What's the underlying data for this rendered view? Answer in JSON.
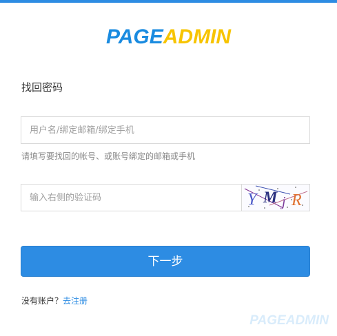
{
  "logo": {
    "part1": "PAGE",
    "part2": "ADMIN"
  },
  "page_title": "找回密码",
  "user_field": {
    "placeholder": "用户名/绑定邮箱/绑定手机",
    "value": ""
  },
  "user_hint": "请填写要找回的帐号、或账号绑定的邮箱或手机",
  "captcha_field": {
    "placeholder": "输入右侧的验证码",
    "value": ""
  },
  "captcha_text": "YMjR",
  "submit_label": "下一步",
  "register": {
    "prompt": "没有账户？",
    "link_label": "去注册"
  },
  "watermark": "PAGEADMIN",
  "colors": {
    "accent": "#2d8ce3",
    "logo_blue": "#1a8be0",
    "logo_yellow": "#f7c400"
  }
}
